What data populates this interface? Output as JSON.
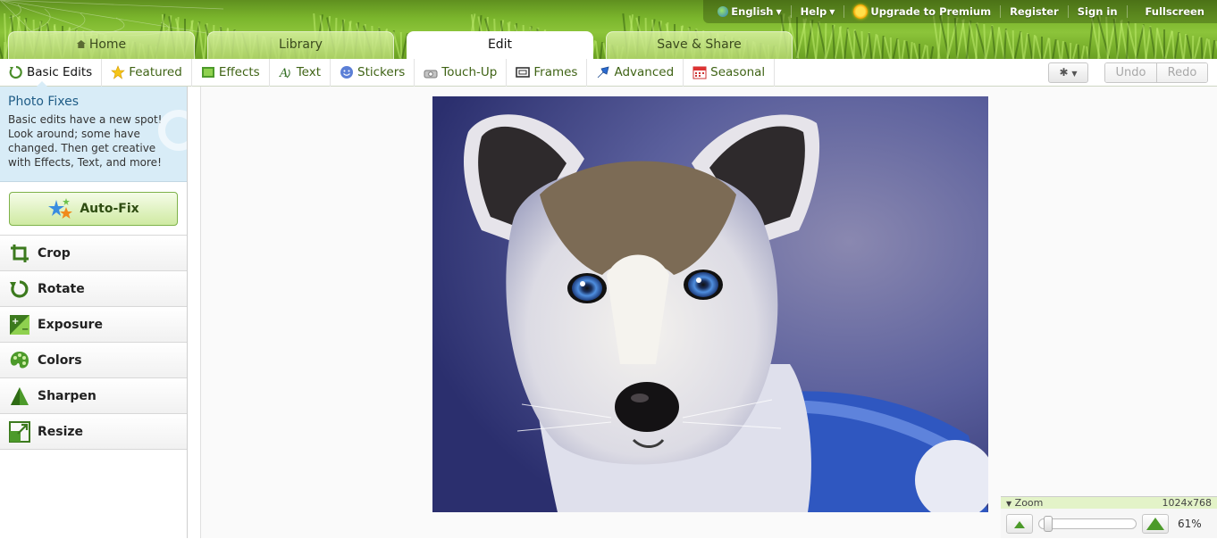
{
  "topbar": {
    "language": "English",
    "help": "Help",
    "upgrade": "Upgrade to Premium",
    "register": "Register",
    "signin": "Sign in",
    "fullscreen": "Fullscreen"
  },
  "main_tabs": [
    {
      "label": "Home",
      "active": false
    },
    {
      "label": "Library",
      "active": false
    },
    {
      "label": "Edit",
      "active": true
    },
    {
      "label": "Save & Share",
      "active": false
    }
  ],
  "sub_tabs": [
    {
      "label": "Basic Edits",
      "icon": "basic-edits-icon",
      "active": true
    },
    {
      "label": "Featured",
      "icon": "star-icon",
      "active": false
    },
    {
      "label": "Effects",
      "icon": "effects-icon",
      "active": false
    },
    {
      "label": "Text",
      "icon": "text-icon",
      "active": false
    },
    {
      "label": "Stickers",
      "icon": "sticker-icon",
      "active": false
    },
    {
      "label": "Touch-Up",
      "icon": "touchup-icon",
      "active": false
    },
    {
      "label": "Frames",
      "icon": "frame-icon",
      "active": false
    },
    {
      "label": "Advanced",
      "icon": "advanced-icon",
      "active": false
    },
    {
      "label": "Seasonal",
      "icon": "calendar-icon",
      "active": false
    }
  ],
  "toolbar": {
    "undo": "Undo",
    "redo": "Redo"
  },
  "info": {
    "title": "Photo Fixes",
    "text": "Basic edits have a new spot! Look around; some have changed. Then get creative with Effects, Text, and more!"
  },
  "autofix_label": "Auto-Fix",
  "tools": [
    {
      "label": "Crop",
      "icon": "crop-icon"
    },
    {
      "label": "Rotate",
      "icon": "rotate-icon"
    },
    {
      "label": "Exposure",
      "icon": "exposure-icon"
    },
    {
      "label": "Colors",
      "icon": "palette-icon"
    },
    {
      "label": "Sharpen",
      "icon": "sharpen-icon"
    },
    {
      "label": "Resize",
      "icon": "resize-icon"
    }
  ],
  "zoom": {
    "label": "Zoom",
    "dimensions": "1024x768",
    "percent": "61%",
    "level": 0.05
  },
  "colors": {
    "accent_green": "#7ab52c",
    "info_blue": "#d8ecf7",
    "photo_bg": "#3d4d9a"
  }
}
